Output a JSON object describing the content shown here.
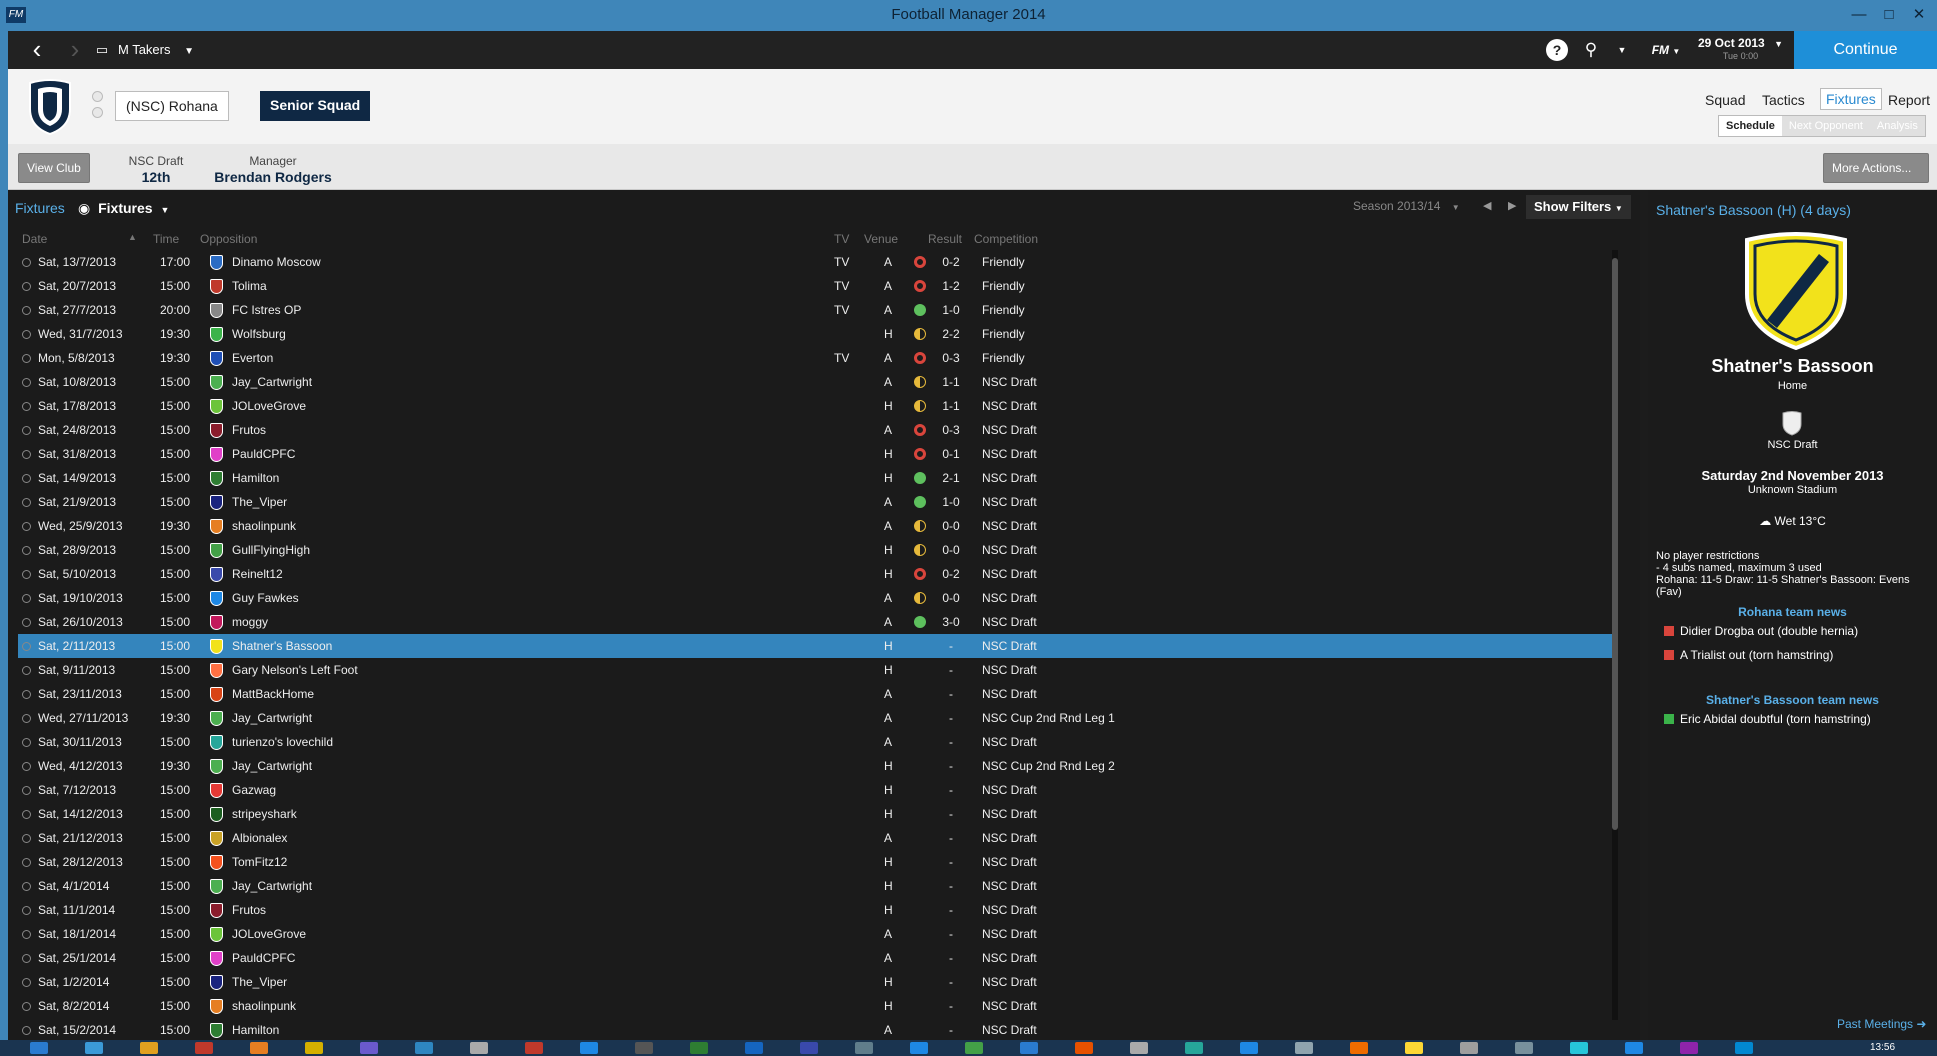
{
  "window": {
    "title": "Football Manager 2014",
    "app_icon": "FM"
  },
  "topbar": {
    "manager": "M Takers",
    "fm_label": "FM",
    "date": "29 Oct 2013",
    "date_sub": "Tue 0:00",
    "continue": "Continue"
  },
  "club": {
    "team_tab": "(NSC) Rohana",
    "squad_tab": "Senior Squad",
    "tabs": [
      "Squad",
      "Tactics",
      "Fixtures",
      "Report"
    ],
    "subtabs": [
      "Schedule",
      "Next Opponent",
      "Analysis"
    ],
    "view_club": "View Club",
    "league_label": "NSC Draft",
    "league_pos": "12th",
    "manager_label": "Manager",
    "manager_name": "Brendan Rodgers",
    "more_actions": "More Actions..."
  },
  "fixtures": {
    "crumb": "Fixtures",
    "view": "Fixtures",
    "season": "Season 2013/14",
    "show_filters": "Show Filters",
    "columns": {
      "date": "Date",
      "time": "Time",
      "opposition": "Opposition",
      "tv": "TV",
      "venue": "Venue",
      "result": "Result",
      "competition": "Competition"
    },
    "rows": [
      {
        "date": "Sat, 13/7/2013",
        "time": "17:00",
        "opp": "Dinamo Moscow",
        "tv": "TV",
        "venue": "A",
        "outcome": "loss",
        "res": "0-2",
        "comp": "Friendly",
        "color": "#2b6cc4"
      },
      {
        "date": "Sat, 20/7/2013",
        "time": "15:00",
        "opp": "Tolima",
        "tv": "TV",
        "venue": "A",
        "outcome": "loss",
        "res": "1-2",
        "comp": "Friendly",
        "color": "#c0392b"
      },
      {
        "date": "Sat, 27/7/2013",
        "time": "20:00",
        "opp": "FC Istres OP",
        "tv": "TV",
        "venue": "A",
        "outcome": "win",
        "res": "1-0",
        "comp": "Friendly",
        "color": "#888888"
      },
      {
        "date": "Wed, 31/7/2013",
        "time": "19:30",
        "opp": "Wolfsburg",
        "tv": "",
        "venue": "H",
        "outcome": "draw",
        "res": "2-2",
        "comp": "Friendly",
        "color": "#3bb34a"
      },
      {
        "date": "Mon, 5/8/2013",
        "time": "19:30",
        "opp": "Everton",
        "tv": "TV",
        "venue": "A",
        "outcome": "loss",
        "res": "0-3",
        "comp": "Friendly",
        "color": "#1f4fb5"
      },
      {
        "date": "Sat, 10/8/2013",
        "time": "15:00",
        "opp": "Jay_Cartwright",
        "tv": "",
        "venue": "A",
        "outcome": "draw",
        "res": "1-1",
        "comp": "NSC Draft",
        "color": "#4caf50"
      },
      {
        "date": "Sat, 17/8/2013",
        "time": "15:00",
        "opp": "JOLoveGrove",
        "tv": "",
        "venue": "H",
        "outcome": "draw",
        "res": "1-1",
        "comp": "NSC Draft",
        "color": "#6cc43a"
      },
      {
        "date": "Sat, 24/8/2013",
        "time": "15:00",
        "opp": "Frutos",
        "tv": "",
        "venue": "A",
        "outcome": "loss",
        "res": "0-3",
        "comp": "NSC Draft",
        "color": "#8b1d2c"
      },
      {
        "date": "Sat, 31/8/2013",
        "time": "15:00",
        "opp": "PauldCPFC",
        "tv": "",
        "venue": "H",
        "outcome": "loss",
        "res": "0-1",
        "comp": "NSC Draft",
        "color": "#e040c8"
      },
      {
        "date": "Sat, 14/9/2013",
        "time": "15:00",
        "opp": "Hamilton",
        "tv": "",
        "venue": "H",
        "outcome": "win",
        "res": "2-1",
        "comp": "NSC Draft",
        "color": "#2e7d32"
      },
      {
        "date": "Sat, 21/9/2013",
        "time": "15:00",
        "opp": "The_Viper",
        "tv": "",
        "venue": "A",
        "outcome": "win",
        "res": "1-0",
        "comp": "NSC Draft",
        "color": "#1a237e"
      },
      {
        "date": "Wed, 25/9/2013",
        "time": "19:30",
        "opp": "shaolinpunk",
        "tv": "",
        "venue": "A",
        "outcome": "draw",
        "res": "0-0",
        "comp": "NSC Draft",
        "color": "#e67e22"
      },
      {
        "date": "Sat, 28/9/2013",
        "time": "15:00",
        "opp": "GullFlyingHigh",
        "tv": "",
        "venue": "H",
        "outcome": "draw",
        "res": "0-0",
        "comp": "NSC Draft",
        "color": "#43a047"
      },
      {
        "date": "Sat, 5/10/2013",
        "time": "15:00",
        "opp": "Reinelt12",
        "tv": "",
        "venue": "H",
        "outcome": "loss",
        "res": "0-2",
        "comp": "NSC Draft",
        "color": "#3949ab"
      },
      {
        "date": "Sat, 19/10/2013",
        "time": "15:00",
        "opp": "Guy Fawkes",
        "tv": "",
        "venue": "A",
        "outcome": "draw",
        "res": "0-0",
        "comp": "NSC Draft",
        "color": "#1e88e5"
      },
      {
        "date": "Sat, 26/10/2013",
        "time": "15:00",
        "opp": "moggy",
        "tv": "",
        "venue": "A",
        "outcome": "win",
        "res": "3-0",
        "comp": "NSC Draft",
        "color": "#c2185b"
      },
      {
        "date": "Sat, 2/11/2013",
        "time": "15:00",
        "opp": "Shatner's Bassoon",
        "tv": "",
        "venue": "H",
        "outcome": "",
        "res": "-",
        "comp": "NSC Draft",
        "color": "#f2e21b",
        "highlight": true
      },
      {
        "date": "Sat, 9/11/2013",
        "time": "15:00",
        "opp": "Gary Nelson's Left Foot",
        "tv": "",
        "venue": "H",
        "outcome": "",
        "res": "-",
        "comp": "NSC Draft",
        "color": "#ff7043"
      },
      {
        "date": "Sat, 23/11/2013",
        "time": "15:00",
        "opp": "MattBackHome",
        "tv": "",
        "venue": "A",
        "outcome": "",
        "res": "-",
        "comp": "NSC Draft",
        "color": "#d84315"
      },
      {
        "date": "Wed, 27/11/2013",
        "time": "19:30",
        "opp": "Jay_Cartwright",
        "tv": "",
        "venue": "A",
        "outcome": "",
        "res": "-",
        "comp": "NSC Cup 2nd Rnd Leg 1",
        "color": "#4caf50"
      },
      {
        "date": "Sat, 30/11/2013",
        "time": "15:00",
        "opp": "turienzo's lovechild",
        "tv": "",
        "venue": "A",
        "outcome": "",
        "res": "-",
        "comp": "NSC Draft",
        "color": "#26a69a"
      },
      {
        "date": "Wed, 4/12/2013",
        "time": "19:30",
        "opp": "Jay_Cartwright",
        "tv": "",
        "venue": "H",
        "outcome": "",
        "res": "-",
        "comp": "NSC Cup 2nd Rnd Leg 2",
        "color": "#4caf50"
      },
      {
        "date": "Sat, 7/12/2013",
        "time": "15:00",
        "opp": "Gazwag",
        "tv": "",
        "venue": "H",
        "outcome": "",
        "res": "-",
        "comp": "NSC Draft",
        "color": "#e53935"
      },
      {
        "date": "Sat, 14/12/2013",
        "time": "15:00",
        "opp": "stripeyshark",
        "tv": "",
        "venue": "H",
        "outcome": "",
        "res": "-",
        "comp": "NSC Draft",
        "color": "#1b5e20"
      },
      {
        "date": "Sat, 21/12/2013",
        "time": "15:00",
        "opp": "Albionalex",
        "tv": "",
        "venue": "A",
        "outcome": "",
        "res": "-",
        "comp": "NSC Draft",
        "color": "#c9a227"
      },
      {
        "date": "Sat, 28/12/2013",
        "time": "15:00",
        "opp": "TomFitz12",
        "tv": "",
        "venue": "H",
        "outcome": "",
        "res": "-",
        "comp": "NSC Draft",
        "color": "#f4511e"
      },
      {
        "date": "Sat, 4/1/2014",
        "time": "15:00",
        "opp": "Jay_Cartwright",
        "tv": "",
        "venue": "H",
        "outcome": "",
        "res": "-",
        "comp": "NSC Draft",
        "color": "#4caf50"
      },
      {
        "date": "Sat, 11/1/2014",
        "time": "15:00",
        "opp": "Frutos",
        "tv": "",
        "venue": "H",
        "outcome": "",
        "res": "-",
        "comp": "NSC Draft",
        "color": "#8b1d2c"
      },
      {
        "date": "Sat, 18/1/2014",
        "time": "15:00",
        "opp": "JOLoveGrove",
        "tv": "",
        "venue": "A",
        "outcome": "",
        "res": "-",
        "comp": "NSC Draft",
        "color": "#6cc43a"
      },
      {
        "date": "Sat, 25/1/2014",
        "time": "15:00",
        "opp": "PauldCPFC",
        "tv": "",
        "venue": "A",
        "outcome": "",
        "res": "-",
        "comp": "NSC Draft",
        "color": "#e040c8"
      },
      {
        "date": "Sat, 1/2/2014",
        "time": "15:00",
        "opp": "The_Viper",
        "tv": "",
        "venue": "H",
        "outcome": "",
        "res": "-",
        "comp": "NSC Draft",
        "color": "#1a237e"
      },
      {
        "date": "Sat, 8/2/2014",
        "time": "15:00",
        "opp": "shaolinpunk",
        "tv": "",
        "venue": "H",
        "outcome": "",
        "res": "-",
        "comp": "NSC Draft",
        "color": "#e67e22"
      },
      {
        "date": "Sat, 15/2/2014",
        "time": "15:00",
        "opp": "Hamilton",
        "tv": "",
        "venue": "A",
        "outcome": "",
        "res": "-",
        "comp": "NSC Draft",
        "color": "#2e7d32"
      }
    ]
  },
  "next_match": {
    "title": "Shatner's Bassoon (H) (4 days)",
    "opponent": "Shatner's Bassoon",
    "venue": "Home",
    "competition": "NSC Draft",
    "date": "Saturday 2nd November 2013",
    "stadium": "Unknown Stadium",
    "weather": "Wet 13°C",
    "restrictions": "No player restrictions",
    "subs": "- 4 subs named, maximum 3 used",
    "odds": "Rohana: 11-5 Draw: 11-5 Shatner's Bassoon: Evens (Fav)",
    "home_news_title": "Rohana team news",
    "home_news": [
      "Didier Drogba out (double hernia)",
      "A Trialist out (torn hamstring)"
    ],
    "away_news_title": "Shatner's Bassoon team news",
    "away_news": [
      "Eric Abidal doubtful (torn hamstring)"
    ],
    "past_meetings": "Past Meetings"
  },
  "taskbar": {
    "clock": "13:56"
  },
  "colors": {
    "accent": "#1e8fd8",
    "title_bar": "#3f86b9",
    "highlight_row": "#3485bd",
    "win": "#5ec05e",
    "loss": "#d9453c",
    "draw": "#e6b93b"
  }
}
